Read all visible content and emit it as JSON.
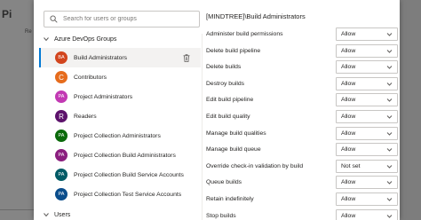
{
  "background": {
    "title": "Pi",
    "tab": "Re"
  },
  "search": {
    "placeholder": "Search for users or groups"
  },
  "groups": [
    {
      "label": "Azure DevOps Groups",
      "expanded": true,
      "items": [
        {
          "initials": "BA",
          "label": "Build Administrators",
          "color": "#d2451e",
          "selected": true
        },
        {
          "initials": "C",
          "label": "Contributors",
          "color": "#e66c1d",
          "selected": false
        },
        {
          "initials": "PA",
          "label": "Project Administrators",
          "color": "#c239b3",
          "selected": false
        },
        {
          "initials": "R",
          "label": "Readers",
          "color": "#5c126b",
          "selected": false
        },
        {
          "initials": "PA",
          "label": "Project Collection Administrators",
          "color": "#0b6a0b",
          "selected": false
        },
        {
          "initials": "PA",
          "label": "Project Collection Build Administrators",
          "color": "#8b1f7f",
          "selected": false
        },
        {
          "initials": "PA",
          "label": "Project Collection Build Service Accounts",
          "color": "#025b66",
          "selected": false
        },
        {
          "initials": "PA",
          "label": "Project Collection Test Service Accounts",
          "color": "#0a4d8c",
          "selected": false
        }
      ]
    },
    {
      "label": "Users",
      "expanded": true,
      "items": []
    }
  ],
  "permissions": {
    "title": "[MINDTREE]\\Build Administrators",
    "rows": [
      {
        "label": "Administer build permissions",
        "value": "Allow"
      },
      {
        "label": "Delete build pipeline",
        "value": "Allow"
      },
      {
        "label": "Delete builds",
        "value": "Allow"
      },
      {
        "label": "Destroy builds",
        "value": "Allow"
      },
      {
        "label": "Edit build pipeline",
        "value": "Allow"
      },
      {
        "label": "Edit build quality",
        "value": "Allow"
      },
      {
        "label": "Manage build qualities",
        "value": "Allow"
      },
      {
        "label": "Manage build queue",
        "value": "Allow"
      },
      {
        "label": "Override check-in validation by build",
        "value": "Not set"
      },
      {
        "label": "Queue builds",
        "value": "Allow"
      },
      {
        "label": "Retain indefinitely",
        "value": "Allow"
      },
      {
        "label": "Stop builds",
        "value": "Allow"
      }
    ]
  },
  "icons": {
    "search": "search-icon",
    "chevron": "chevron-down-icon",
    "delete": "trash-icon"
  }
}
